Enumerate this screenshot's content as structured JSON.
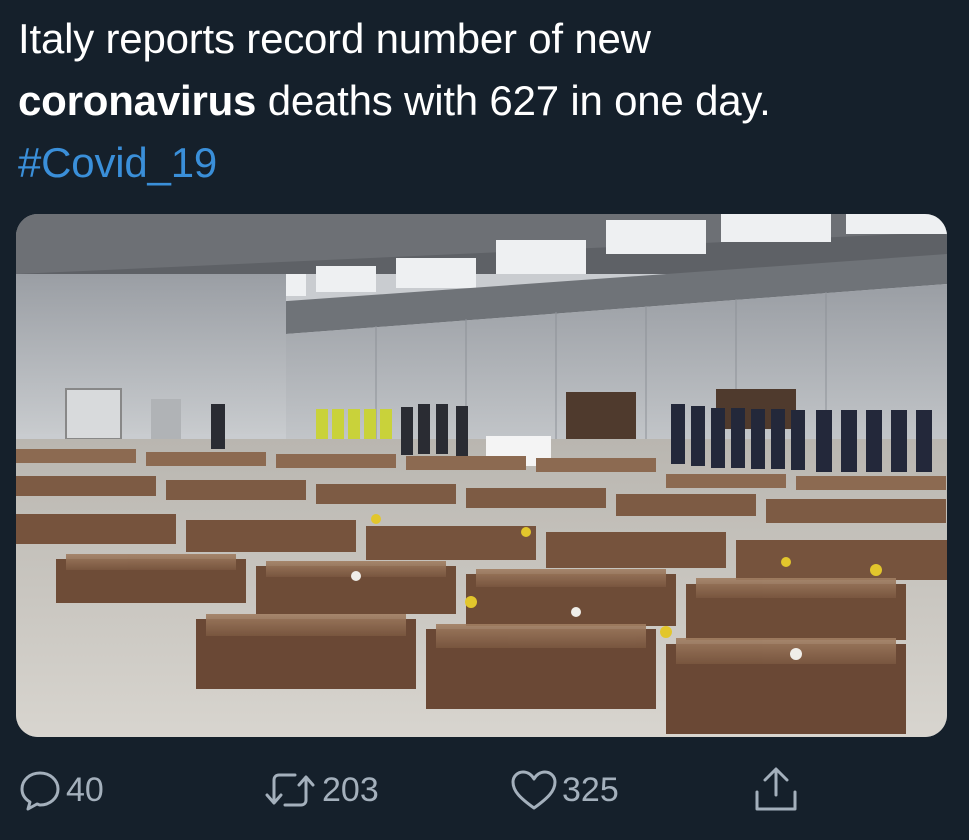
{
  "tweet": {
    "line1": "Italy reports record number of new",
    "line2_bold": "coronavirus",
    "line2_rest": " deaths with 627 in one day.",
    "hashtag": "#Covid_19"
  },
  "colors": {
    "background": "#15202b",
    "text": "#ffffff",
    "hashtag": "#3a8fd9",
    "action_gray": "#a4b0bc"
  },
  "actions": {
    "reply": {
      "icon": "reply-icon",
      "count": "40"
    },
    "retweet": {
      "icon": "retweet-icon",
      "count": "203"
    },
    "like": {
      "icon": "heart-icon",
      "count": "325"
    },
    "share": {
      "icon": "share-icon"
    }
  }
}
